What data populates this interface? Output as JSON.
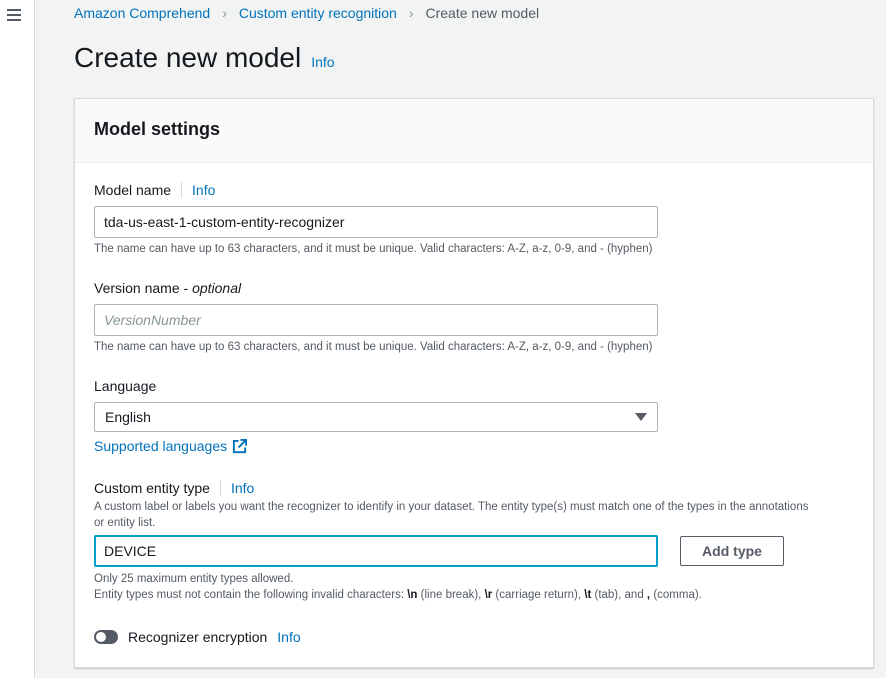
{
  "breadcrumb": {
    "items": [
      "Amazon Comprehend",
      "Custom entity recognition"
    ],
    "current": "Create new model"
  },
  "page": {
    "title": "Create new model",
    "info": "Info"
  },
  "panel": {
    "title": "Model settings"
  },
  "model_name": {
    "label": "Model name",
    "info": "Info",
    "value": "tda-us-east-1-custom-entity-recognizer",
    "hint": "The name can have up to 63 characters, and it must be unique. Valid characters: A-Z, a-z, 0-9, and - (hyphen)"
  },
  "version_name": {
    "label": "Version name - ",
    "optional": "optional",
    "placeholder": "VersionNumber",
    "hint": "The name can have up to 63 characters, and it must be unique. Valid characters: A-Z, a-z, 0-9, and - (hyphen)"
  },
  "language": {
    "label": "Language",
    "selected": "English",
    "link": "Supported languages"
  },
  "entity_type": {
    "label": "Custom entity type",
    "info": "Info",
    "description": "A custom label or labels you want the recognizer to identify in your dataset. The entity type(s) must match one of the types in the annotations or entity list.",
    "value": "DEVICE",
    "add_button": "Add type",
    "hint1": "Only 25 maximum entity types allowed.",
    "hint2_prefix": "Entity types must not contain the following invalid characters: ",
    "c1": "\\n",
    "d1": " (line break), ",
    "c2": "\\r",
    "d2": " (carriage return), ",
    "c3": "\\t",
    "d3": " (tab), and ",
    "c4": ",",
    "d4": " (comma)."
  },
  "encryption": {
    "label": "Recognizer encryption",
    "info": "Info",
    "enabled": false
  },
  "colors": {
    "link": "#0073bb",
    "focus": "#00a1c9",
    "background": "#f2f3f3"
  }
}
